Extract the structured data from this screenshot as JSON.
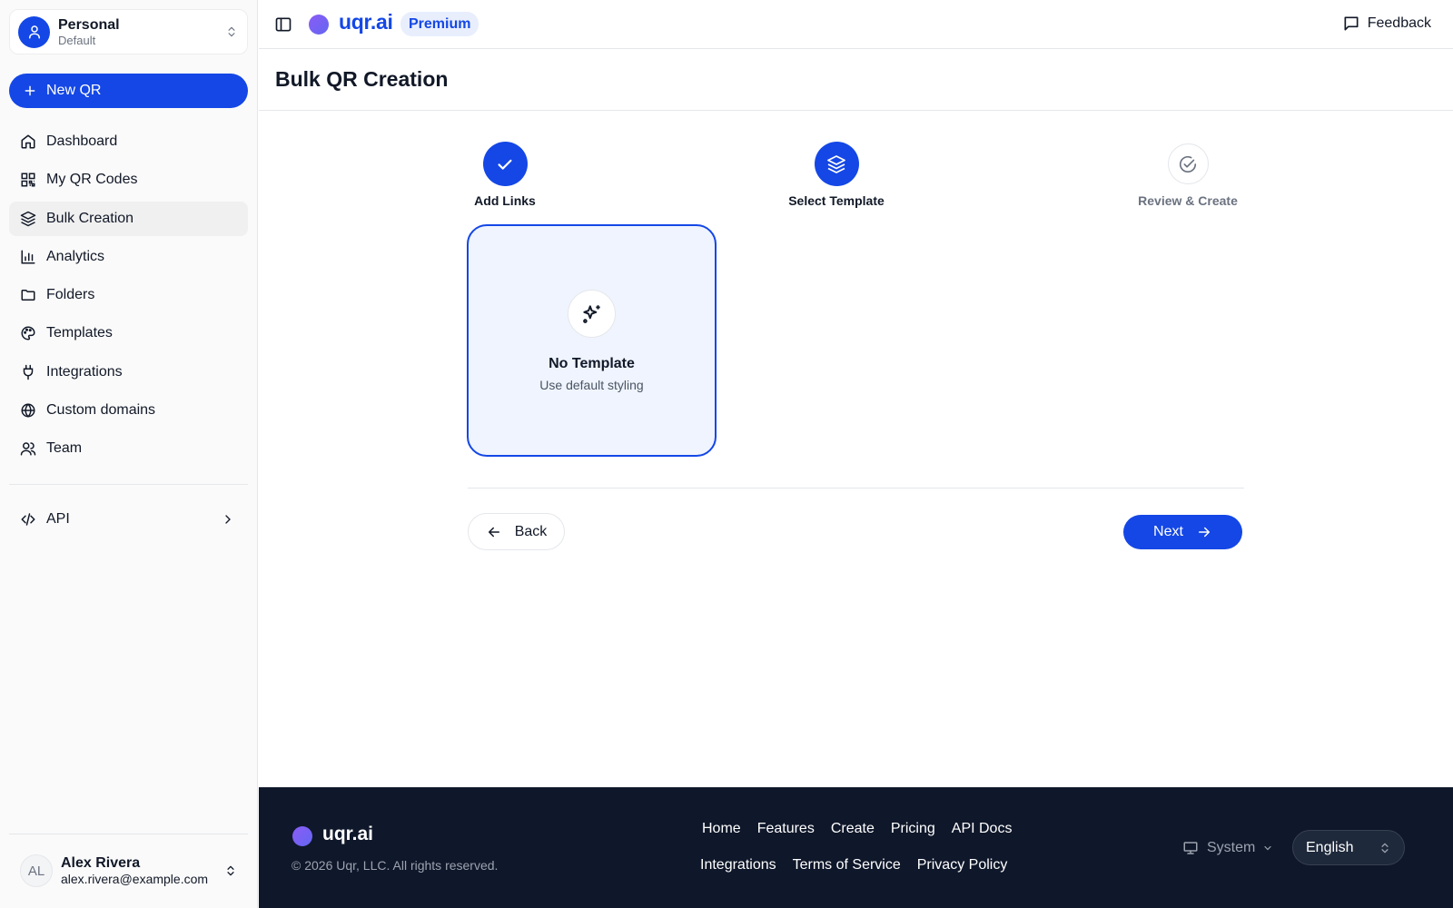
{
  "workspace": {
    "name": "Personal",
    "subtitle": "Default"
  },
  "new_qr_label": "New QR",
  "nav": [
    {
      "label": "Dashboard",
      "icon": "home-icon"
    },
    {
      "label": "My QR Codes",
      "icon": "qr-code-icon"
    },
    {
      "label": "Bulk Creation",
      "icon": "layers-icon",
      "active": true
    },
    {
      "label": "Analytics",
      "icon": "bar-chart-icon"
    },
    {
      "label": "Folders",
      "icon": "folder-icon"
    },
    {
      "label": "Templates",
      "icon": "palette-icon"
    },
    {
      "label": "Integrations",
      "icon": "plug-icon"
    },
    {
      "label": "Custom domains",
      "icon": "globe-icon"
    },
    {
      "label": "Team",
      "icon": "users-icon"
    }
  ],
  "api_label": "API",
  "user": {
    "initials": "AL",
    "name": "Alex Rivera",
    "email": "alex.rivera@example.com"
  },
  "header": {
    "brand": "uqr.ai",
    "plan_badge": "Premium",
    "feedback_label": "Feedback"
  },
  "page_title": "Bulk QR Creation",
  "steps": [
    {
      "label": "Add Links",
      "state": "done"
    },
    {
      "label": "Select Template",
      "state": "current"
    },
    {
      "label": "Review & Create",
      "state": "todo"
    }
  ],
  "template_card": {
    "title": "No Template",
    "subtitle": "Use default styling"
  },
  "buttons": {
    "back": "Back",
    "next": "Next"
  },
  "footer": {
    "brand": "uqr.ai",
    "copyright": "© 2026 Uqr, LLC. All rights reserved.",
    "links_row1": [
      "Home",
      "Features",
      "Create",
      "Pricing",
      "API Docs"
    ],
    "links_row2": [
      "Integrations",
      "Terms of Service",
      "Privacy Policy"
    ],
    "theme": "System",
    "language": "English"
  },
  "colors": {
    "accent": "#1447e6",
    "footer_bg": "#0f172a",
    "card_bg": "#eff4fe"
  }
}
